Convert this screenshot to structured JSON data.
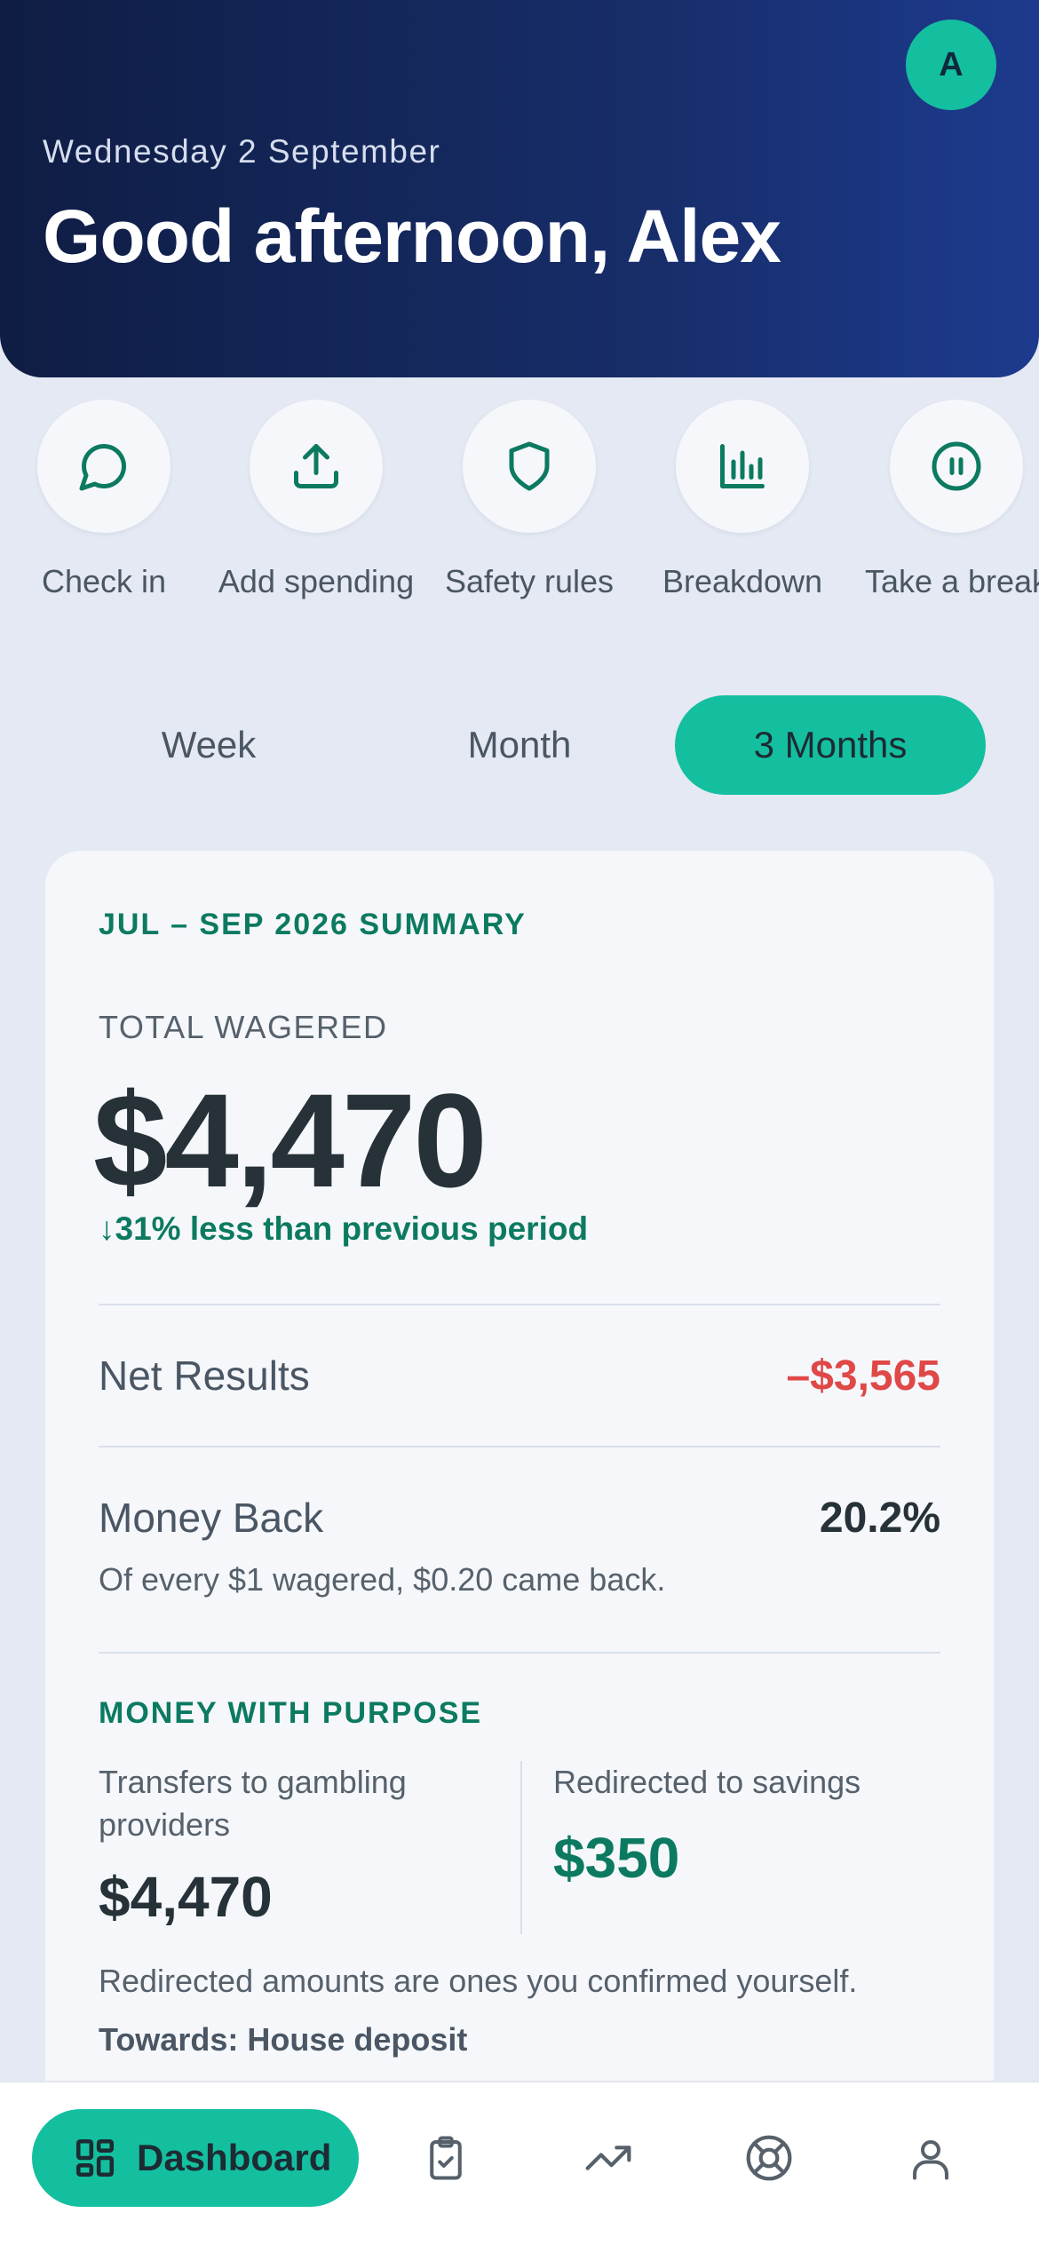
{
  "header": {
    "avatar_initial": "A",
    "date": "Wednesday 2 September",
    "greeting": "Good afternoon, Alex"
  },
  "quick_actions": [
    {
      "label": "Check in",
      "icon": "chat-bubble-icon"
    },
    {
      "label": "Add spending",
      "icon": "upload-icon"
    },
    {
      "label": "Safety rules",
      "icon": "shield-icon"
    },
    {
      "label": "Breakdown",
      "icon": "bar-chart-icon"
    },
    {
      "label": "Take a break",
      "icon": "pause-icon"
    }
  ],
  "period_tabs": [
    {
      "label": "Week",
      "active": false
    },
    {
      "label": "Month",
      "active": false
    },
    {
      "label": "3 Months",
      "active": true
    }
  ],
  "summary": {
    "title": "JUL – SEP 2026 SUMMARY",
    "total_wagered_label": "TOTAL WAGERED",
    "total_wagered_value": "$4,470",
    "change_arrow": "↓",
    "change_text": "31% less than previous period",
    "net_results_label": "Net Results",
    "net_results_value": "–$3,565",
    "money_back_label": "Money Back",
    "money_back_value": "20.2%",
    "money_back_sub": "Of every $1 wagered, $0.20 came back."
  },
  "purpose": {
    "title": "MONEY WITH PURPOSE",
    "transfers_label": "Transfers to gambling providers",
    "transfers_value": "$4,470",
    "savings_label": "Redirected to savings",
    "savings_value": "$350",
    "note": "Redirected amounts are ones you confirmed yourself.",
    "towards": "Towards: House deposit"
  },
  "bottom_nav": {
    "active_label": "Dashboard",
    "items": [
      "dashboard-icon",
      "clipboard-check-icon",
      "trending-up-icon",
      "lifebuoy-icon",
      "user-icon"
    ]
  },
  "colors": {
    "accent": "#14bfa0",
    "positive_text": "#0c7a60",
    "negative_text": "#e04848",
    "header_dark": "#0f1d44"
  }
}
